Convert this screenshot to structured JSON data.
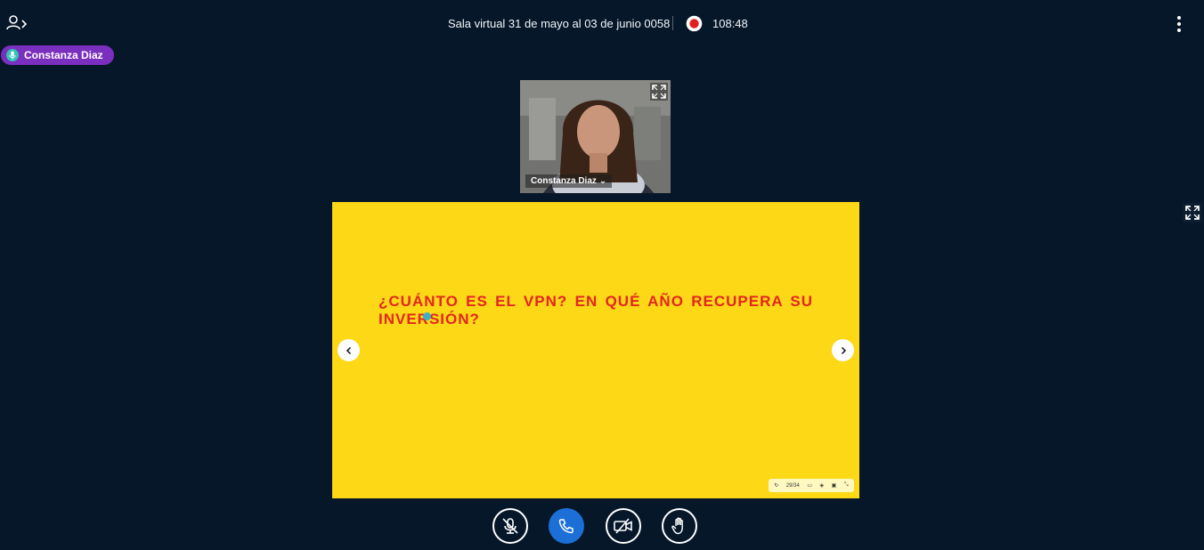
{
  "header": {
    "meeting_title": "Sala virtual 31 de mayo al 03 de junio 0058",
    "recording_time": "108:48",
    "recording_color": "#e0201a"
  },
  "talking_indicator": {
    "name": "Constanza Diaz",
    "color": "#7b2fbf"
  },
  "webcam": {
    "user_name": "Constanza Diaz"
  },
  "presentation": {
    "slide_text": "¿CUÁNTO ES EL VPN? EN QUÉ AÑO RECUPERA SU INVERSIÓN?",
    "background": "#fdd816",
    "text_color": "#e3261f",
    "toolbar_page": "29/34"
  },
  "controls": {
    "mic": "unmute-microphone-icon",
    "audio": "phone-icon",
    "camera": "camera-off-icon",
    "raise_hand": "hand-icon",
    "audio_color": "#1b6fd6"
  }
}
